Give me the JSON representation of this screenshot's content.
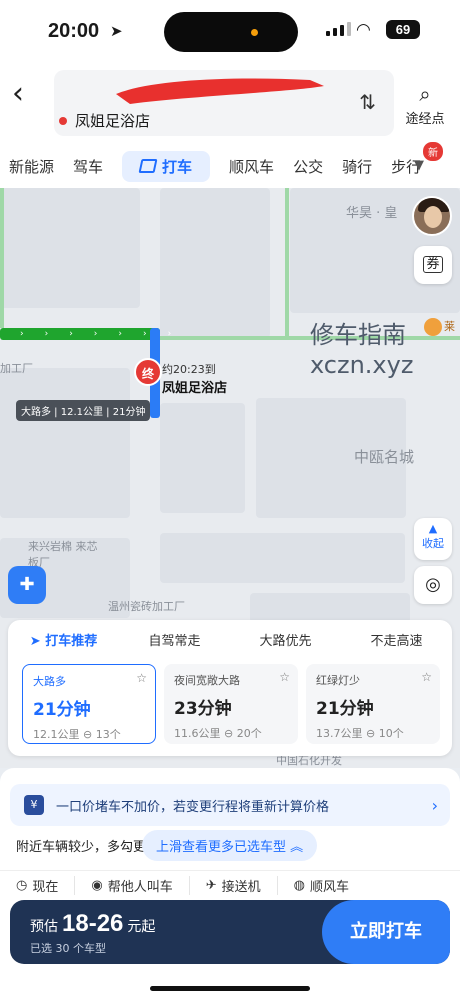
{
  "status_bar": {
    "time": "20:00",
    "battery": "69"
  },
  "header": {
    "destination": "凤姐足浴店",
    "waypoint_label": "途经点",
    "tabs": [
      {
        "label": "新能源"
      },
      {
        "label": "驾车"
      },
      {
        "label": "打车"
      },
      {
        "label": "顺风车"
      },
      {
        "label": "公交"
      },
      {
        "label": "骑行"
      },
      {
        "label": "步行"
      }
    ],
    "new_badge": "新"
  },
  "map": {
    "arrival_time": "约20:23到",
    "destination_label": "凤姐足浴店",
    "end_marker": "终",
    "route_info": "大路多 | 12.1公里 | 21分钟",
    "labels": [
      "华昊 · 皇",
      "中瓯名城",
      "来兴岩棉 来芯板厂",
      "温州瓷砖加工厂",
      "中国石化开发",
      "加工厂",
      "莱"
    ],
    "watermark_line1": "修车指南",
    "watermark_line2": "xczn.xyz",
    "coupon": "券",
    "collapse_label": "收起"
  },
  "route_options": {
    "tabs": [
      {
        "label": "打车推荐",
        "selected": true
      },
      {
        "label": "自驾常走",
        "selected": false
      },
      {
        "label": "大路优先",
        "selected": false
      },
      {
        "label": "不走高速",
        "selected": false
      }
    ],
    "cards": [
      {
        "tag": "大路多",
        "duration": "21分钟",
        "distance": "12.1公里",
        "lights": "13个",
        "selected": true
      },
      {
        "tag": "夜间宽敞大路",
        "duration": "23分钟",
        "distance": "11.6公里",
        "lights": "20个",
        "selected": false
      },
      {
        "tag": "红绿灯少",
        "duration": "21分钟",
        "distance": "13.7公里",
        "lights": "10个",
        "selected": false
      }
    ]
  },
  "sheet": {
    "banner_text": "一口价堵车不加价，若变更行程将重新计算价格",
    "yen_icon": "¥",
    "nearby_text": "附近车辆较少，多勾更",
    "slide_hint": "上滑查看更多已选车型",
    "services": [
      {
        "label": "现在",
        "icon": "clock-icon"
      },
      {
        "label": "帮他人叫车",
        "icon": "person-icon"
      },
      {
        "label": "接送机",
        "icon": "plane-icon"
      },
      {
        "label": "顺风车",
        "icon": "car-icon"
      }
    ],
    "estimate_prefix": "预估",
    "estimate_range": "18-26",
    "estimate_suffix": "元起",
    "selected_count": "已选 30 个车型",
    "call_button": "立即打车"
  },
  "colors": {
    "accent": "#2f7df6",
    "route_green": "#1fa52e",
    "order_bar": "#1f3354",
    "end_pin": "#e53935"
  }
}
